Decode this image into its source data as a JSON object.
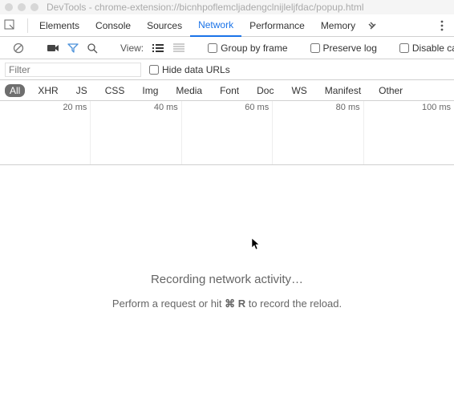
{
  "window": {
    "title": "DevTools - chrome-extension://bicnhpoflemcljadengclnijleljfdac/popup.html"
  },
  "tabs": {
    "elements": "Elements",
    "console": "Console",
    "sources": "Sources",
    "network": "Network",
    "performance": "Performance",
    "memory": "Memory"
  },
  "toolbar": {
    "view_label": "View:",
    "group_by_frame": "Group by frame",
    "preserve_log": "Preserve log",
    "disable_cache": "Disable cache"
  },
  "filter": {
    "placeholder": "Filter",
    "hide_data_urls": "Hide data URLs"
  },
  "types": {
    "all": "All",
    "xhr": "XHR",
    "js": "JS",
    "css": "CSS",
    "img": "Img",
    "media": "Media",
    "font": "Font",
    "doc": "Doc",
    "ws": "WS",
    "manifest": "Manifest",
    "other": "Other"
  },
  "timeline": {
    "ticks": [
      "20 ms",
      "40 ms",
      "60 ms",
      "80 ms",
      "100 ms"
    ]
  },
  "empty": {
    "headline": "Recording network activity…",
    "sub_pre": "Perform a request or hit ",
    "shortcut": "⌘ R",
    "sub_post": " to record the reload."
  }
}
